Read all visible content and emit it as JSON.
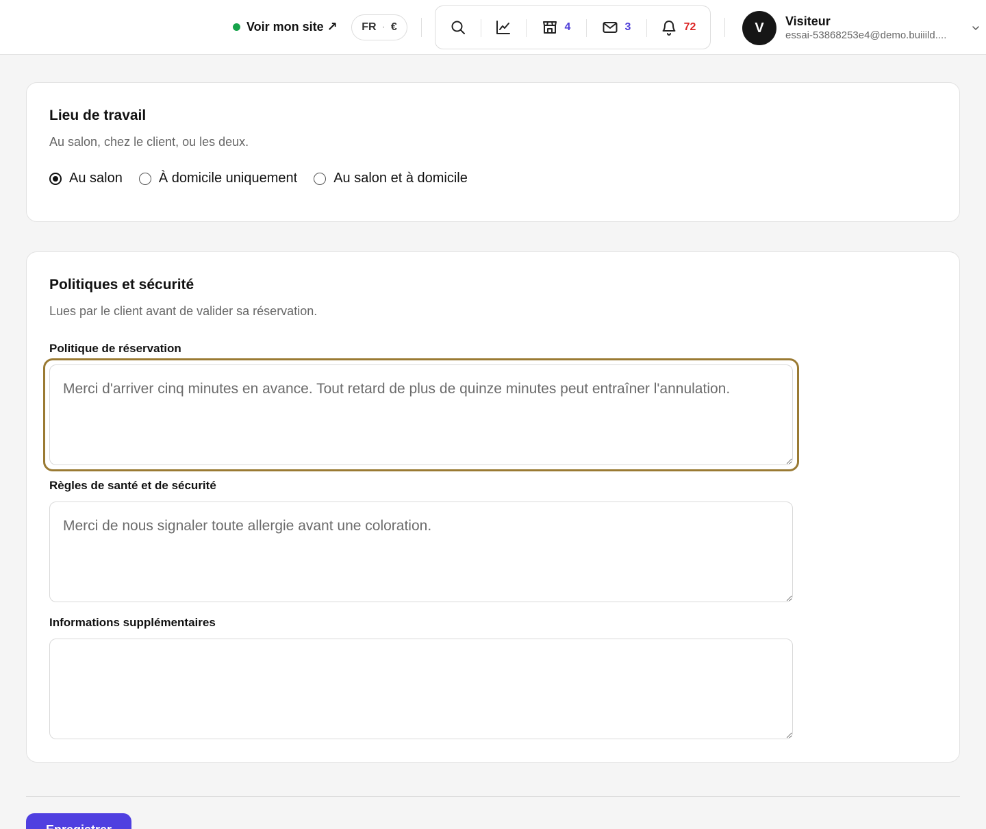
{
  "header": {
    "site_link": "Voir mon site ↗",
    "lang": "FR",
    "currency": "€",
    "tools": [
      {
        "icon": "search-icon"
      },
      {
        "icon": "chart-line-icon"
      },
      {
        "icon": "store-icon",
        "count": "4"
      },
      {
        "icon": "mail-icon",
        "count": "3"
      },
      {
        "icon": "bell-icon",
        "count": "72"
      }
    ],
    "user": {
      "initial": "V",
      "name": "Visiteur",
      "email": "essai-53868253e4@demo.buiiild...."
    }
  },
  "workplace": {
    "title": "Lieu de travail",
    "subtitle": "Au salon, chez le client, ou les deux.",
    "options": [
      {
        "label": "Au salon",
        "selected": true
      },
      {
        "label": "À domicile uniquement",
        "selected": false
      },
      {
        "label": "Au salon et à domicile",
        "selected": false
      }
    ]
  },
  "policies": {
    "title": "Politiques et sécurité",
    "subtitle": "Lues par le client avant de valider sa réservation.",
    "booking_label": "Politique de réservation",
    "booking_placeholder": "Merci d'arriver cinq minutes en avance. Tout retard de plus de quinze minutes peut entraîner l'annulation.",
    "health_label": "Règles de santé et de sécurité",
    "health_placeholder": "Merci de nous signaler toute allergie avant une coloration.",
    "extra_label": "Informations supplémentaires",
    "extra_placeholder": ""
  },
  "footer": {
    "save_label": "Enregistrer"
  },
  "colors": {
    "accent": "#4f3fe0",
    "focus_ring": "#9a7a33",
    "online": "#16a34a",
    "badge_blue": "#4f3fd8",
    "badge_red": "#dc2626"
  }
}
